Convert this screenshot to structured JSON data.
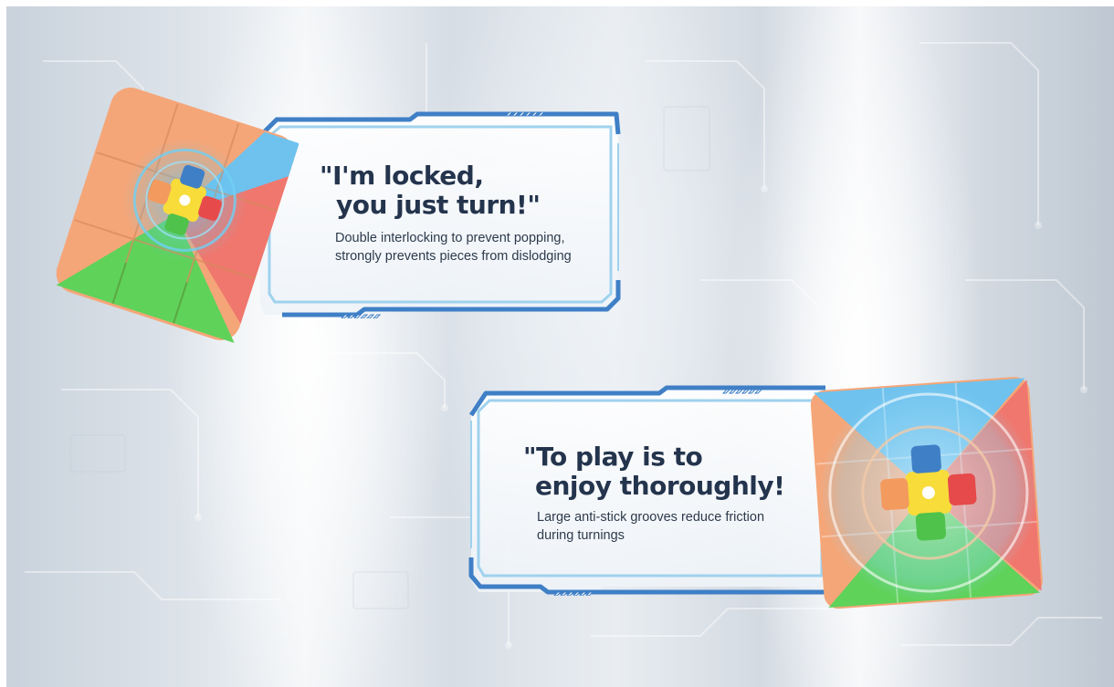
{
  "panels": [
    {
      "title_line1": "\"I'm locked,",
      "title_line2": "you just turn!\"",
      "desc_line1": "Double interlocking to prevent popping,",
      "desc_line2": "strongly prevents pieces from dislodging"
    },
    {
      "title_line1": "\"To play is to",
      "title_line2": "enjoy thoroughly!",
      "desc_line1": "Large anti-stick grooves reduce friction",
      "desc_line2": "during turnings"
    }
  ],
  "colors": {
    "frame_blue": "#3f7fc6",
    "frame_light": "#9fd2ee",
    "title_text": "#24344d",
    "desc_text": "#2d3a4c",
    "cube_orange": "#f5a678",
    "cube_green": "#5fd25a",
    "cube_red": "#f0776e",
    "cube_blue": "#6fc2ee",
    "cube_yellow": "#f7dc3a"
  }
}
